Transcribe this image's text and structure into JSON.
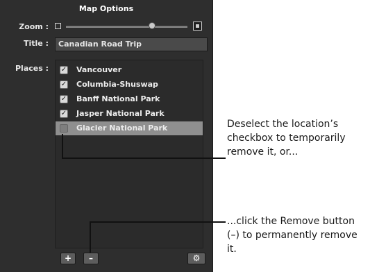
{
  "panel": {
    "title": "Map Options",
    "zoom": {
      "label": "Zoom :",
      "level": 0.7
    },
    "title_field": {
      "label": "Title :",
      "value": "Canadian Road Trip"
    },
    "places": {
      "label": "Places :",
      "items": [
        {
          "label": "Vancouver",
          "checked": true,
          "selected": false
        },
        {
          "label": "Columbia-Shuswap",
          "checked": true,
          "selected": false
        },
        {
          "label": "Banff National Park",
          "checked": true,
          "selected": false
        },
        {
          "label": "Jasper National Park",
          "checked": true,
          "selected": false
        },
        {
          "label": "Glacier National Park",
          "checked": false,
          "selected": true
        }
      ]
    },
    "toolbar": {
      "add_label": "+",
      "remove_label": "–",
      "gear_icon": "gear-icon"
    }
  },
  "callouts": {
    "checkbox_note": "Deselect the location’s checkbox to temporarily remove it, or...",
    "remove_note": "...click the Remove button (–) to permanently remove it."
  },
  "colors": {
    "panel_bg": "#2e2e2e",
    "selection": "#8f8f8f",
    "text_light": "#ececec"
  }
}
